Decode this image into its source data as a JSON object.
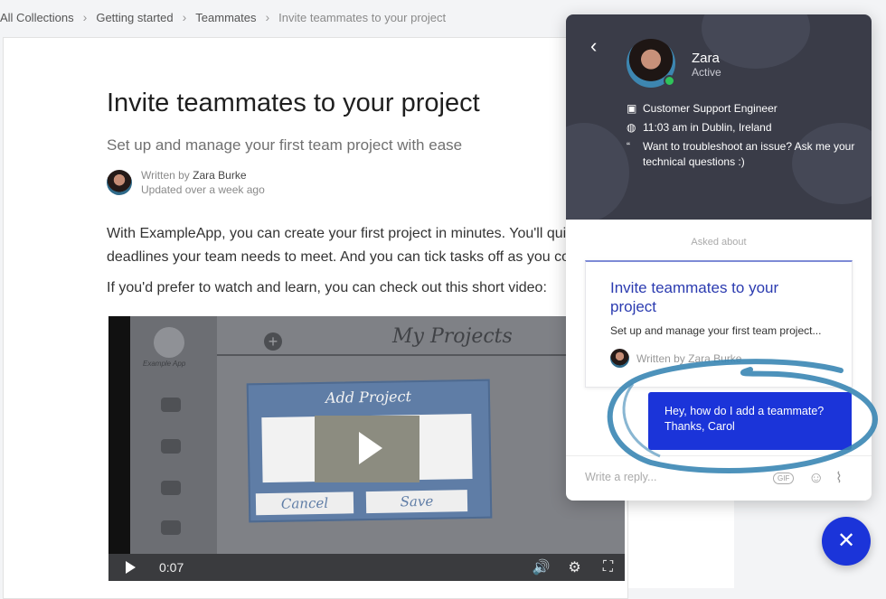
{
  "breadcrumb": {
    "items": [
      "All Collections",
      "Getting started",
      "Teammates"
    ],
    "current": "Invite teammates to your project"
  },
  "article": {
    "title": "Invite teammates to your project",
    "subtitle": "Set up and manage your first team project with ease",
    "written_by_label": "Written by",
    "author": "Zara Burke",
    "updated": "Updated over a week ago",
    "para1_line1": "With ExampleApp, you can create your first project in minutes. You'll quickly",
    "para1_line2": "deadlines your team needs to meet. And you can tick tasks off as you compl",
    "para2": "If you'd prefer to watch and learn, you can check out this short video:"
  },
  "video": {
    "sketch_title": "My Projects",
    "sketch_logo": "Example App",
    "dialog_title": "Add Project",
    "cancel_label": "Cancel",
    "save_label": "Save",
    "time": "0:07"
  },
  "chat": {
    "agent_name": "Zara",
    "agent_status": "Active",
    "role": "Customer Support Engineer",
    "local_time": "11:03 am in Dublin, Ireland",
    "quote_line1": "Want to troubleshoot an issue? Ask me your",
    "quote_line2": "technical questions :)",
    "asked_about": "Asked about",
    "card_title": "Invite teammates to your project",
    "card_subtitle": "Set up and manage your first team project...",
    "card_author": "Written by Zara Burke",
    "message_line1": "Hey, how do I add a teammate?",
    "message_line2": "Thanks, Carol",
    "reply_placeholder": "Write a reply...",
    "gif_label": "GIF"
  },
  "colors": {
    "accent": "#1b34d9",
    "header_bg": "#3a3c48",
    "annotation_ring": "#3a86b4",
    "online": "#2fc45a"
  },
  "icons": [
    "chevron-right-icon",
    "back-arrow-icon",
    "briefcase-icon",
    "globe-icon",
    "quote-icon",
    "play-icon",
    "volume-icon",
    "settings-icon",
    "fullscreen-icon",
    "emoji-icon",
    "attachment-icon",
    "close-icon"
  ]
}
